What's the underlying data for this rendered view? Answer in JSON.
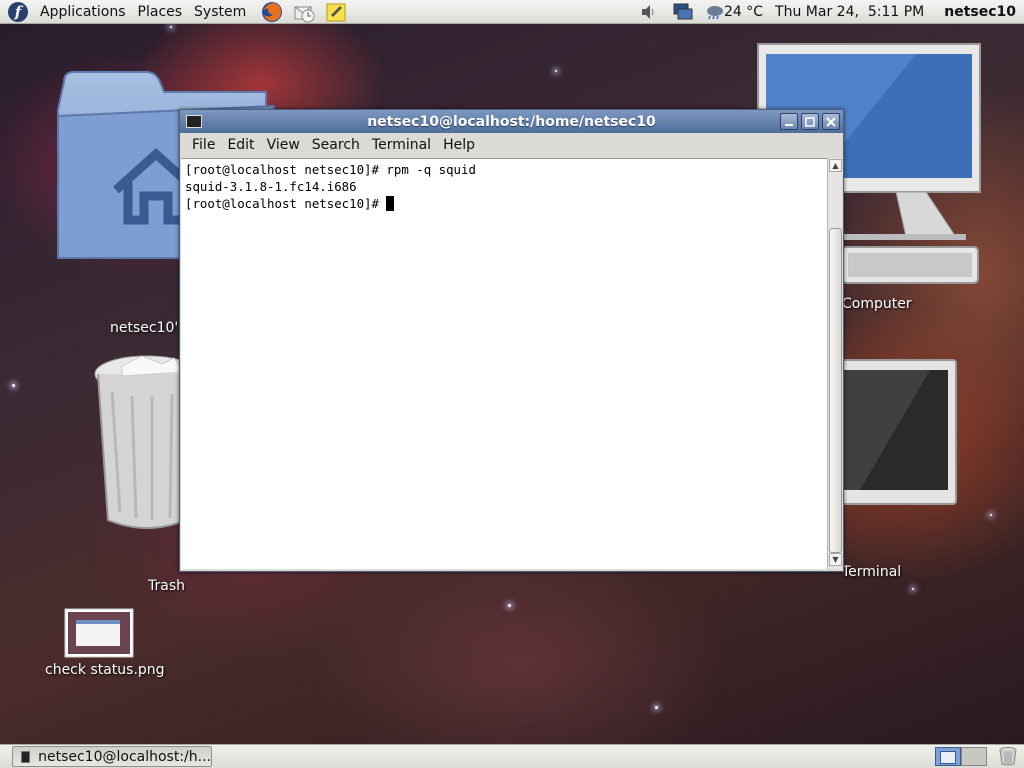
{
  "top_panel": {
    "menus": [
      "Applications",
      "Places",
      "System"
    ],
    "launchers": [
      "firefox-icon",
      "mail-clock-icon",
      "notes-icon"
    ],
    "tray": [
      "volume-icon",
      "network-icon"
    ],
    "weather": "24 °C",
    "clock": "Thu Mar 24,  5:11 PM",
    "user": "netsec10"
  },
  "desktop_icons": {
    "home": "netsec10's",
    "computer": "Computer",
    "trash": "Trash",
    "terminal": "Terminal",
    "screenshot": "check status.png"
  },
  "terminal_window": {
    "title": "netsec10@localhost:/home/netsec10",
    "menus": [
      "File",
      "Edit",
      "View",
      "Search",
      "Terminal",
      "Help"
    ],
    "lines": [
      "[root@localhost netsec10]# rpm -q squid",
      "squid-3.1.8-1.fc14.i686",
      "[root@localhost netsec10]# "
    ]
  },
  "bottom_panel": {
    "task_label": "netsec10@localhost:/h..."
  },
  "colors": {
    "titlebar": "#5a78a8",
    "panel": "#e6e6e0"
  }
}
